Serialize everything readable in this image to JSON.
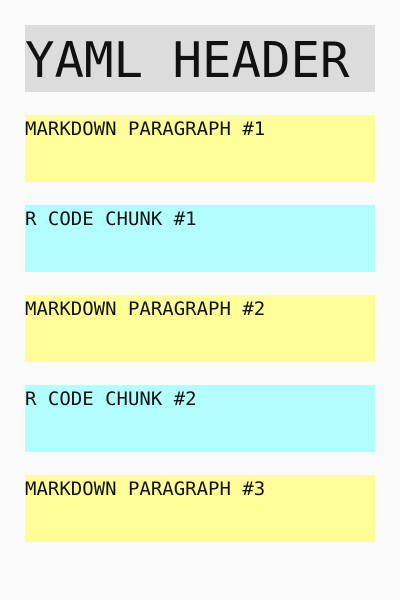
{
  "header": {
    "label": "YAML HEADER"
  },
  "blocks": [
    {
      "label": "MARKDOWN PARAGRAPH #1"
    },
    {
      "label": "R CODE CHUNK #1"
    },
    {
      "label": "MARKDOWN PARAGRAPH #2"
    },
    {
      "label": "R CODE CHUNK #2"
    },
    {
      "label": "MARKDOWN PARAGRAPH #3"
    }
  ],
  "colors": {
    "yaml": "#dcdcdc",
    "markdown": "#ffff99",
    "code": "#b3ffff",
    "background": "#fafafa",
    "text": "#111111"
  }
}
